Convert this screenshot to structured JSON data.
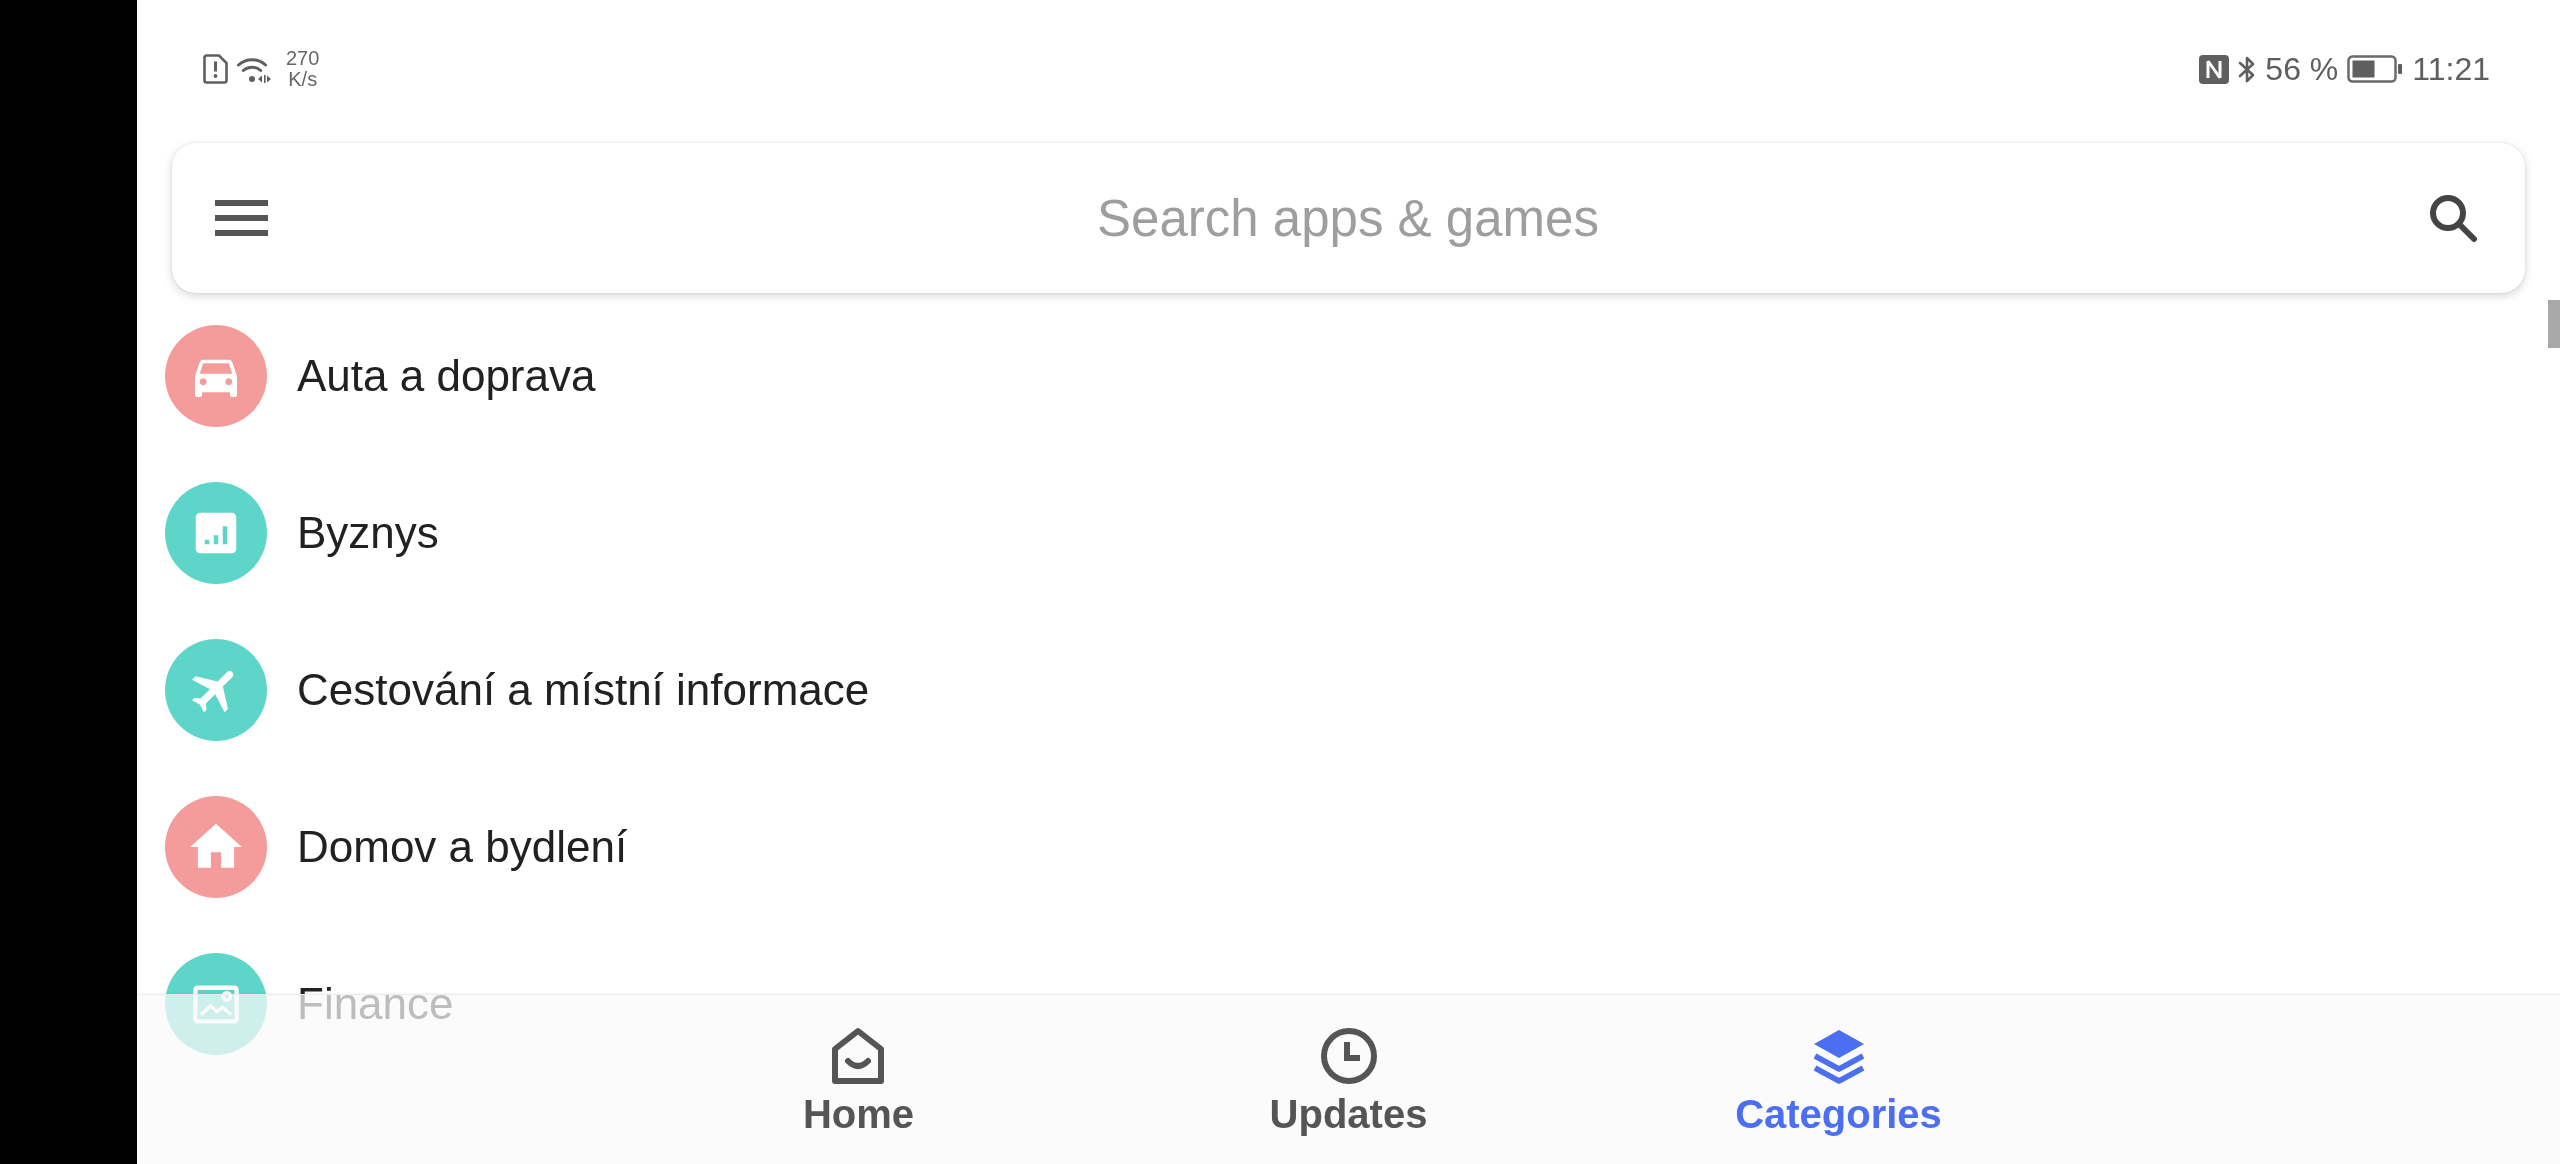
{
  "status_bar": {
    "network_speed": "270",
    "network_speed_unit": "K/s",
    "battery_percent": "56 %",
    "time": "11:21"
  },
  "search": {
    "placeholder": "Search apps & games"
  },
  "categories": [
    {
      "kind": "car",
      "label": "Auta a doprava",
      "color": "#f49c9b"
    },
    {
      "kind": "chart",
      "label": "Byznys",
      "color": "#5dd5c8"
    },
    {
      "kind": "plane",
      "label": "Cestování a místní informace",
      "color": "#5dd5c8"
    },
    {
      "kind": "house",
      "label": "Domov a bydlení",
      "color": "#f49c9b"
    },
    {
      "kind": "card",
      "label": "Finance",
      "color": "#5dd5c8"
    }
  ],
  "bottom_nav": [
    {
      "kind": "home",
      "label": "Home",
      "selected": false
    },
    {
      "kind": "clock",
      "label": "Updates",
      "selected": false
    },
    {
      "kind": "layers",
      "label": "Categories",
      "selected": true
    }
  ]
}
